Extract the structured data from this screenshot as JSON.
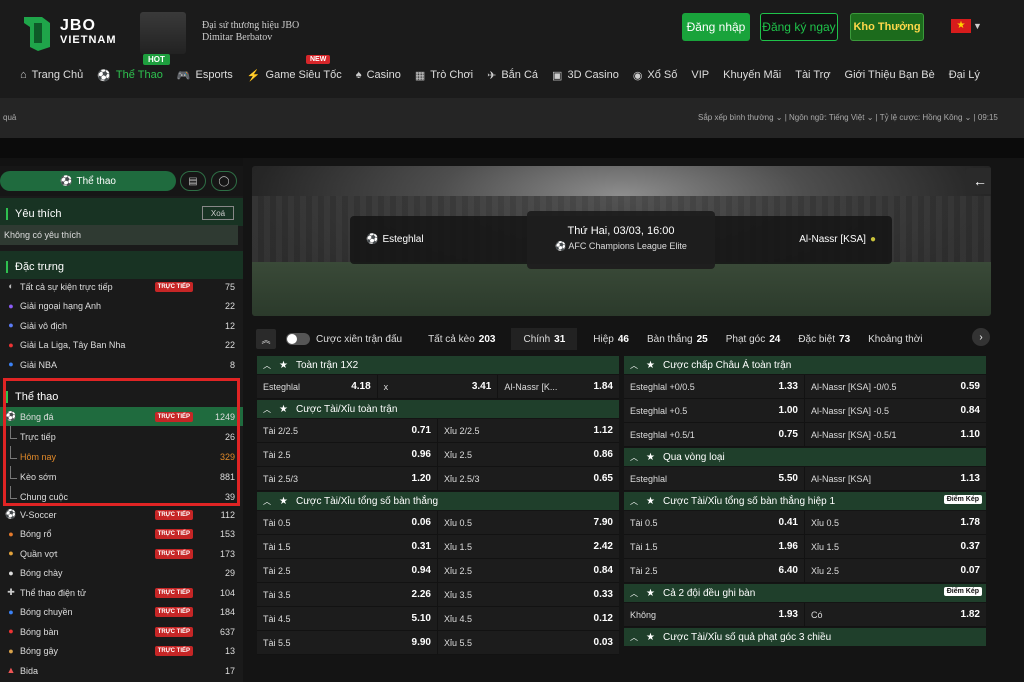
{
  "header": {
    "logo_l1": "JBO",
    "logo_l2": "VIETNAM",
    "ambassador_l1": "Đại sứ thương hiệu JBO",
    "ambassador_l2": "Dimitar Berbatov",
    "hot": "HOT",
    "new": "NEW",
    "login": "Đăng nhập",
    "register": "Đăng ký ngay",
    "bonus": "Kho Thưởng",
    "flag": "★"
  },
  "nav": [
    {
      "label": "Trang Chủ",
      "icon": "⌂"
    },
    {
      "label": "Thể Thao",
      "icon": "⚽"
    },
    {
      "label": "Esports",
      "icon": "🎮"
    },
    {
      "label": "Game Siêu Tốc",
      "icon": "⚡"
    },
    {
      "label": "Casino",
      "icon": "♠"
    },
    {
      "label": "Trò Chơi",
      "icon": "▦"
    },
    {
      "label": "Bắn Cá",
      "icon": "✈"
    },
    {
      "label": "3D Casino",
      "icon": "▣"
    },
    {
      "label": "Xổ Số",
      "icon": "◉"
    },
    {
      "label": "VIP",
      "icon": ""
    },
    {
      "label": "Khuyến Mãi",
      "icon": ""
    },
    {
      "label": "Tài Trợ",
      "icon": ""
    },
    {
      "label": "Giới Thiệu Bạn Bè",
      "icon": ""
    },
    {
      "label": "Đại Lý",
      "icon": ""
    }
  ],
  "subbar": {
    "left": "quả",
    "right": "Sắp xếp bình thường ⌄ | Ngôn ngữ: Tiếng Việt ⌄ | Tỷ lệ cược: Hồng Kông ⌄ | 09:15"
  },
  "sidebar": {
    "tab_sports": "Thể thao",
    "fav_title": "Yêu thích",
    "fav_clear": "Xoá",
    "no_fav": "Không có yêu thích",
    "special_title": "Đặc trưng",
    "special": [
      {
        "label": "Tất cả sự kiện trực tiếp",
        "icon": "◐",
        "live": "TRỰC TIẾP",
        "count": "75"
      },
      {
        "label": "Giải ngoại hạng Anh",
        "icon": "●",
        "live": "",
        "count": "22"
      },
      {
        "label": "Giải vô địch",
        "icon": "●",
        "live": "",
        "count": "12"
      },
      {
        "label": "Giải La Liga, Tây Ban Nha",
        "icon": "●",
        "live": "",
        "count": "22"
      },
      {
        "label": "Giải NBA",
        "icon": "●",
        "live": "",
        "count": "8"
      }
    ],
    "sports_title": "Thể thao",
    "football": {
      "label": "Bóng đá",
      "live": "TRỰC TIẾP",
      "count": "1249"
    },
    "football_sub": [
      {
        "label": "Trực tiếp",
        "count": "26"
      },
      {
        "label": "Hôm nay",
        "count": "329"
      },
      {
        "label": "Kèo sớm",
        "count": "881"
      },
      {
        "label": "Chung cuộc",
        "count": "39"
      }
    ],
    "sports": [
      {
        "label": "V-Soccer",
        "icon": "⚽",
        "live": "TRỰC TIẾP",
        "count": "112"
      },
      {
        "label": "Bóng rổ",
        "icon": "●",
        "live": "TRỰC TIẾP",
        "count": "153"
      },
      {
        "label": "Quần vợt",
        "icon": "●",
        "live": "TRỰC TIẾP",
        "count": "173"
      },
      {
        "label": "Bóng chày",
        "icon": "●",
        "live": "",
        "count": "29"
      },
      {
        "label": "Thể thao điện tử",
        "icon": "✚",
        "live": "TRỰC TIẾP",
        "count": "104"
      },
      {
        "label": "Bóng chuyền",
        "icon": "●",
        "live": "TRỰC TIẾP",
        "count": "184"
      },
      {
        "label": "Bóng bàn",
        "icon": "●",
        "live": "TRỰC TIẾP",
        "count": "637"
      },
      {
        "label": "Bóng gậy",
        "icon": "●",
        "live": "TRỰC TIẾP",
        "count": "13"
      },
      {
        "label": "Bida",
        "icon": "▲",
        "live": "",
        "count": "17"
      }
    ]
  },
  "match": {
    "home": "Esteghlal",
    "away": "Al-Nassr [KSA]",
    "datetime": "Thứ Hai, 03/03, 16:00",
    "league": "AFC Champions League Elite"
  },
  "tabs": {
    "parlay": "Cược xiên trận đấu",
    "items": [
      {
        "label": "Tất cả kèo",
        "count": "203"
      },
      {
        "label": "Chính",
        "count": "31"
      },
      {
        "label": "Hiệp",
        "count": "46"
      },
      {
        "label": "Bàn thắng",
        "count": "25"
      },
      {
        "label": "Phạt góc",
        "count": "24"
      },
      {
        "label": "Đặc biệt",
        "count": "73"
      },
      {
        "label": "Khoảng thời",
        "count": ""
      }
    ]
  },
  "left_blocks": [
    {
      "title": "Toàn trận 1X2",
      "badge": "",
      "rows": [
        [
          {
            "l": "Esteghlal",
            "o": "4.18"
          },
          {
            "l": "x",
            "o": "3.41"
          },
          {
            "l": "Al-Nassr [K...",
            "o": "1.84"
          }
        ]
      ]
    },
    {
      "title": "Cược Tài/Xỉu toàn trận",
      "badge": "",
      "rows": [
        [
          {
            "l": "Tài 2/2.5",
            "o": "0.71"
          },
          {
            "l": "Xỉu 2/2.5",
            "o": "1.12"
          }
        ],
        [
          {
            "l": "Tài 2.5",
            "o": "0.96"
          },
          {
            "l": "Xỉu 2.5",
            "o": "0.86"
          }
        ],
        [
          {
            "l": "Tài 2.5/3",
            "o": "1.20"
          },
          {
            "l": "Xỉu 2.5/3",
            "o": "0.65"
          }
        ]
      ]
    },
    {
      "title": "Cược Tài/Xỉu tổng số bàn thắng",
      "badge": "",
      "rows": [
        [
          {
            "l": "Tài 0.5",
            "o": "0.06"
          },
          {
            "l": "Xỉu 0.5",
            "o": "7.90"
          }
        ],
        [
          {
            "l": "Tài 1.5",
            "o": "0.31"
          },
          {
            "l": "Xỉu 1.5",
            "o": "2.42"
          }
        ],
        [
          {
            "l": "Tài 2.5",
            "o": "0.94"
          },
          {
            "l": "Xỉu 2.5",
            "o": "0.84"
          }
        ],
        [
          {
            "l": "Tài 3.5",
            "o": "2.26"
          },
          {
            "l": "Xỉu 3.5",
            "o": "0.33"
          }
        ],
        [
          {
            "l": "Tài 4.5",
            "o": "5.10"
          },
          {
            "l": "Xỉu 4.5",
            "o": "0.12"
          }
        ],
        [
          {
            "l": "Tài 5.5",
            "o": "9.90"
          },
          {
            "l": "Xỉu 5.5",
            "o": "0.03"
          }
        ]
      ]
    }
  ],
  "right_blocks": [
    {
      "title": "Cược chấp Châu Á toàn trận",
      "badge": "",
      "rows": [
        [
          {
            "l": "Esteghlal +0/0.5",
            "o": "1.33"
          },
          {
            "l": "Al-Nassr [KSA] -0/0.5",
            "o": "0.59"
          }
        ],
        [
          {
            "l": "Esteghlal +0.5",
            "o": "1.00"
          },
          {
            "l": "Al-Nassr [KSA] -0.5",
            "o": "0.84"
          }
        ],
        [
          {
            "l": "Esteghlal +0.5/1",
            "o": "0.75"
          },
          {
            "l": "Al-Nassr [KSA] -0.5/1",
            "o": "1.10"
          }
        ]
      ]
    },
    {
      "title": "Qua vòng loại",
      "badge": "",
      "rows": [
        [
          {
            "l": "Esteghlal",
            "o": "5.50"
          },
          {
            "l": "Al-Nassr [KSA]",
            "o": "1.13"
          }
        ]
      ]
    },
    {
      "title": "Cược Tài/Xỉu tổng số bàn thắng hiệp 1",
      "badge": "Điểm Kép",
      "rows": [
        [
          {
            "l": "Tài 0.5",
            "o": "0.41"
          },
          {
            "l": "Xỉu 0.5",
            "o": "1.78"
          }
        ],
        [
          {
            "l": "Tài 1.5",
            "o": "1.96"
          },
          {
            "l": "Xỉu 1.5",
            "o": "0.37"
          }
        ],
        [
          {
            "l": "Tài 2.5",
            "o": "6.40"
          },
          {
            "l": "Xỉu 2.5",
            "o": "0.07"
          }
        ]
      ]
    },
    {
      "title": "Cả 2 đội đều ghi bàn",
      "badge": "Điểm Kép",
      "rows": [
        [
          {
            "l": "Không",
            "o": "1.93"
          },
          {
            "l": "Có",
            "o": "1.82"
          }
        ]
      ]
    },
    {
      "title": "Cược Tài/Xỉu số quả phạt góc 3 chiều",
      "badge": "",
      "rows": []
    }
  ],
  "colors": {
    "accent": "#2ec14f",
    "live": "#c62626",
    "highlight": "#e02424"
  }
}
